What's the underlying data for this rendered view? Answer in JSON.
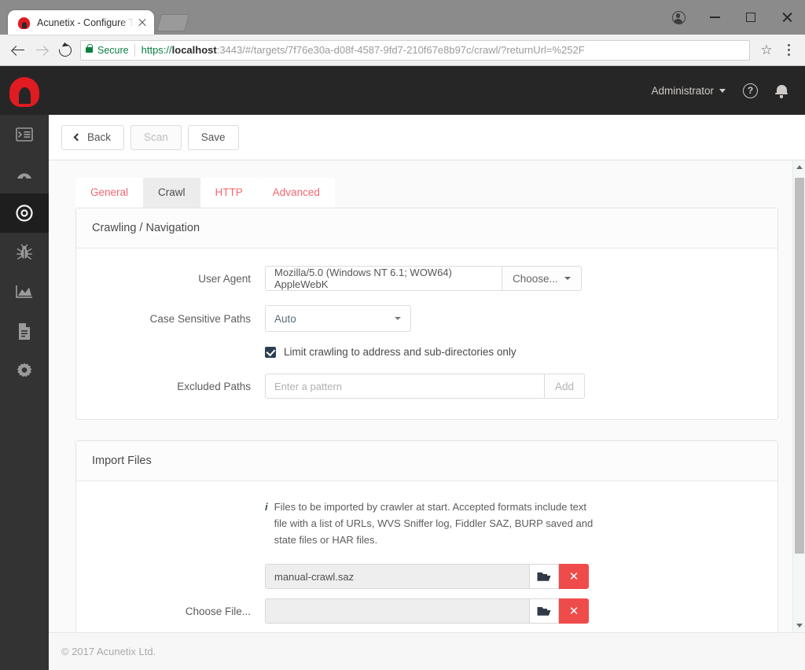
{
  "browser": {
    "tab": {
      "title": "Acunetix - Configure Targ",
      "favicon": "acunetix-logo-icon",
      "close": "×"
    },
    "newtab_label": "",
    "window_controls": {
      "profile": "profile-icon",
      "minimize": "−",
      "maximize": "□",
      "close": "✕"
    },
    "nav": {
      "back": "←",
      "forward": "→",
      "reload": "⟳"
    },
    "omnibox": {
      "security_label": "Secure",
      "url_scheme": "https://",
      "url_host": "localhost",
      "url_rest": ":3443/#/targets/7f76e30a-d08f-4587-9fd7-210f67e8b97c/crawl/?returnUrl=%252F",
      "bookmark_icon": "☆",
      "menu_icon": "kebab-menu-icon"
    }
  },
  "app": {
    "header": {
      "logo": "acunetix-logo-icon",
      "user_menu": "Administrator",
      "help_icon": "?",
      "bell_icon": "notifications-bell-icon"
    },
    "sidebar": {
      "items": [
        {
          "name": "dashboard-list",
          "icon": "list-panel-icon",
          "active": false
        },
        {
          "name": "scans",
          "icon": "speedometer-icon",
          "active": false
        },
        {
          "name": "targets",
          "icon": "target-icon",
          "active": true
        },
        {
          "name": "vulnerabilities",
          "icon": "bug-icon",
          "active": false
        },
        {
          "name": "reports-chart",
          "icon": "area-chart-icon",
          "active": false
        },
        {
          "name": "reports",
          "icon": "document-icon",
          "active": false
        },
        {
          "name": "settings",
          "icon": "gear-icon",
          "active": false
        }
      ]
    },
    "toolbar": {
      "back_label": "Back",
      "scan_label": "Scan",
      "save_label": "Save"
    },
    "tabs": [
      {
        "label": "General",
        "active": false
      },
      {
        "label": "Crawl",
        "active": true
      },
      {
        "label": "HTTP",
        "active": false
      },
      {
        "label": "Advanced",
        "active": false
      }
    ],
    "crawling_panel": {
      "title": "Crawling / Navigation",
      "user_agent": {
        "label": "User Agent",
        "value": "Mozilla/5.0 (Windows NT 6.1; WOW64) AppleWebK",
        "choose_label": "Choose..."
      },
      "case_sensitive": {
        "label": "Case Sensitive Paths",
        "value": "Auto"
      },
      "limit_crawling": {
        "label": "Limit crawling to address and sub-directories only",
        "checked": true
      },
      "excluded_paths": {
        "label": "Excluded Paths",
        "placeholder": "Enter a pattern",
        "value": "",
        "add_label": "Add"
      }
    },
    "import_panel": {
      "title": "Import Files",
      "info_icon": "i",
      "info_text": "Files to be imported by crawler at start. Accepted formats include text file with a list of URLs, WVS Sniffer log, Fiddler SAZ, BURP saved and state files or HAR files.",
      "rows": [
        {
          "label": "",
          "value": "manual-crawl.saz",
          "browse_icon": "folder-open-icon",
          "delete_icon": "✕"
        },
        {
          "label": "Choose File...",
          "value": "",
          "browse_icon": "folder-open-icon",
          "delete_icon": "✕"
        }
      ]
    },
    "footer": {
      "copyright": "© 2017 Acunetix Ltd."
    }
  },
  "colors": {
    "brand_red": "#e01b22",
    "tab_link": "#f2676f",
    "sidebar": "#333333",
    "header": "#262626",
    "danger": "#ef4b4b",
    "checkbox": "#2c3e50"
  }
}
